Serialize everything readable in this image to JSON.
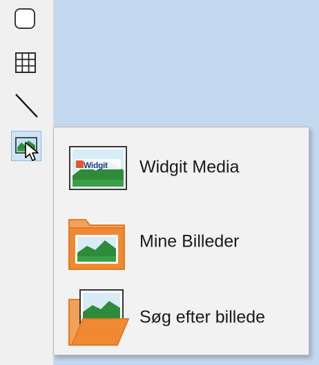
{
  "toolbar": {
    "tools": [
      {
        "name": "rounded-rectangle"
      },
      {
        "name": "table-grid"
      },
      {
        "name": "line"
      },
      {
        "name": "insert-picture"
      }
    ]
  },
  "menu": {
    "items": [
      {
        "label": "Widgit Media",
        "icon": "widgit-media-icon",
        "logo_text": "Widgit"
      },
      {
        "label": "Mine Billeder",
        "icon": "folder-picture-icon"
      },
      {
        "label": "Søg efter billede",
        "icon": "open-folder-picture-icon"
      }
    ]
  },
  "colors": {
    "canvas": "#c3d7ef",
    "toolbar": "#f0f0f0",
    "menu_bg": "#f2f2f2",
    "folder_orange": "#f08a32",
    "landscape_green": "#2e8b3a",
    "landscape_sky": "#d8ecf6"
  }
}
